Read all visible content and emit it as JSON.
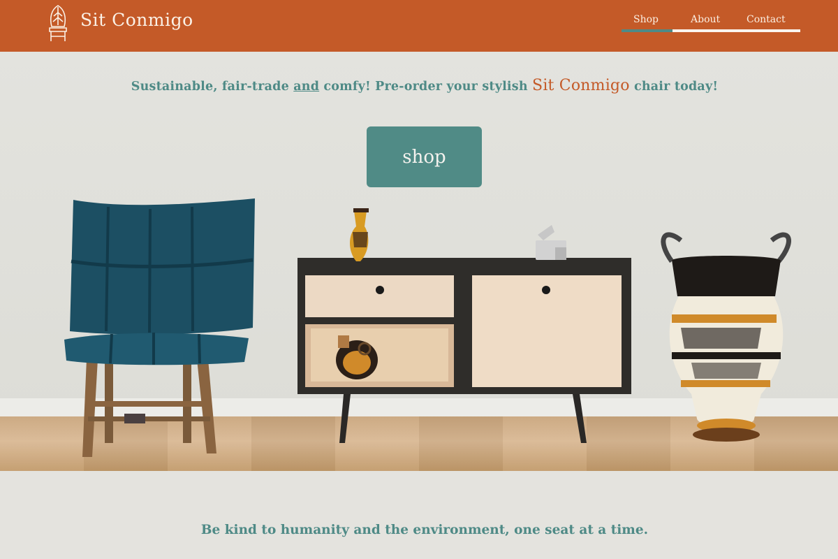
{
  "header": {
    "brand": "Sit Conmigo",
    "logo_icon": "chair-leaf-icon",
    "nav": [
      {
        "label": "Shop",
        "active": true
      },
      {
        "label": "About",
        "active": false
      },
      {
        "label": "Contact",
        "active": false
      }
    ]
  },
  "hero": {
    "tagline_start": "Sustainable, fair-trade ",
    "tagline_and": "and",
    "tagline_mid": " comfy! Pre-order your stylish ",
    "tagline_brand": "Sit Conmigo",
    "tagline_end": " chair today!",
    "shop_button": "shop",
    "image_items": [
      "armchair",
      "sideboard",
      "vase",
      "figurine",
      "amphora"
    ]
  },
  "footer": {
    "tagline": "Be kind to humanity and the environment, one seat at a time."
  },
  "colors": {
    "brand_orange": "#c45a28",
    "teal": "#4e8a86",
    "background": "#e4e3de"
  }
}
